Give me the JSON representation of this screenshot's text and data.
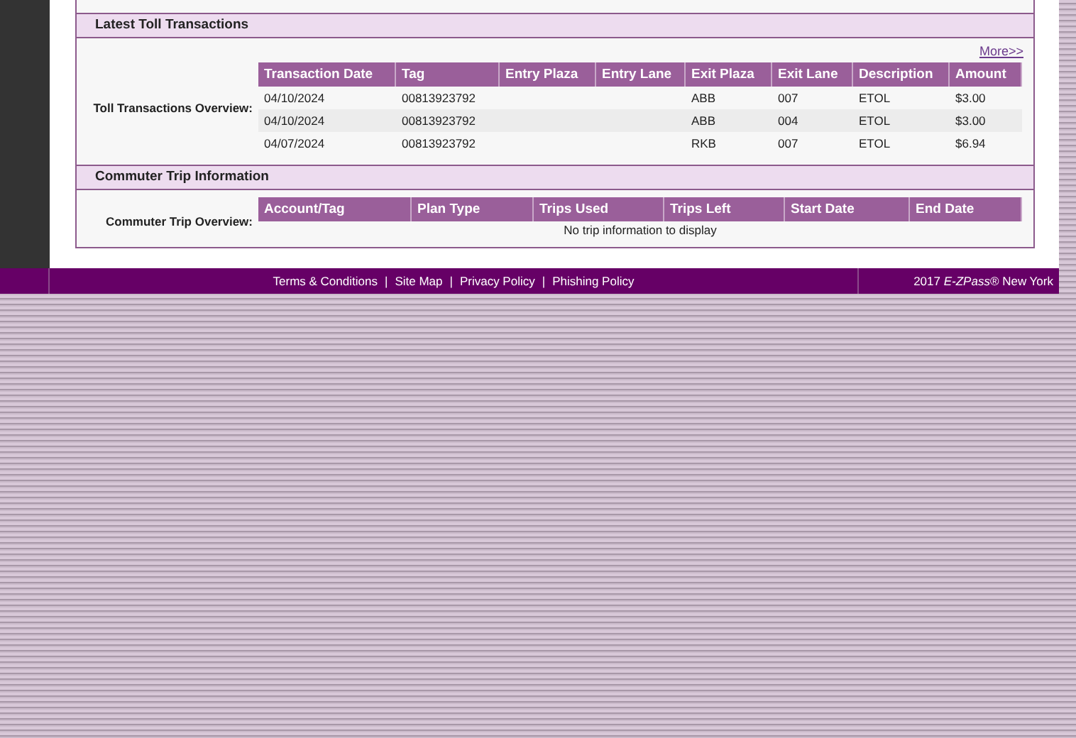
{
  "toll_section": {
    "title": "Latest Toll Transactions",
    "more_link": "More>>",
    "overview_label": "Toll Transactions Overview:",
    "columns": [
      "Transaction Date",
      "Tag",
      "Entry Plaza",
      "Entry Lane",
      "Exit Plaza",
      "Exit Lane",
      "Description",
      "Amount"
    ],
    "rows": [
      [
        "04/10/2024",
        "00813923792",
        "",
        "",
        "ABB",
        "007",
        "ETOL",
        "$3.00"
      ],
      [
        "04/10/2024",
        "00813923792",
        "",
        "",
        "ABB",
        "004",
        "ETOL",
        "$3.00"
      ],
      [
        "04/07/2024",
        "00813923792",
        "",
        "",
        "RKB",
        "007",
        "ETOL",
        "$6.94"
      ]
    ]
  },
  "commuter_section": {
    "title": "Commuter Trip Information",
    "overview_label": "Commuter Trip Overview:",
    "columns": [
      "Account/Tag",
      "Plan Type",
      "Trips Used",
      "Trips Left",
      "Start Date",
      "End Date"
    ],
    "empty_message": "No trip information to display"
  },
  "footer": {
    "separator": "|",
    "links": [
      "Terms & Conditions",
      "Site Map",
      "Privacy Policy",
      "Phishing Policy"
    ],
    "copyright": "2017 *E-ZPass*® New York"
  }
}
